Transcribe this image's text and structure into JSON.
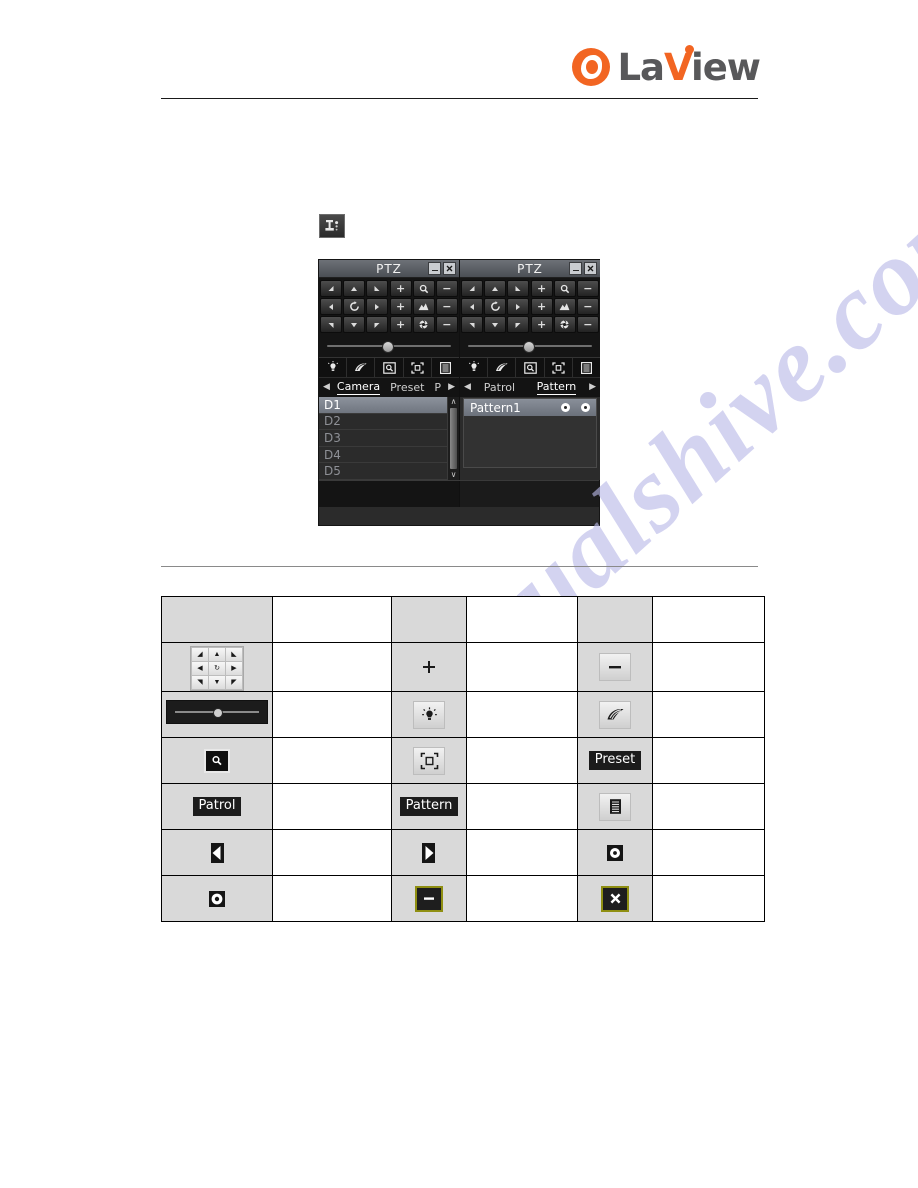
{
  "header": {
    "logo_la": "La",
    "logo_v": "V",
    "logo_iew": "iew",
    "logo_name": "LaView"
  },
  "watermark": {
    "text": "manualshive.com"
  },
  "ptz_tool_icon": {
    "name": "ptz-control-icon"
  },
  "ptz_panels": [
    {
      "title": "PTZ",
      "minimize_label": "_",
      "close_label": "×",
      "dpad": [
        "arrow-up-left",
        "arrow-up",
        "arrow-up-right",
        "arrow-left",
        "auto-scan",
        "arrow-right",
        "arrow-down-left",
        "arrow-down",
        "arrow-down-right"
      ],
      "zoom_controls": [
        {
          "plus": "+",
          "icon": "zoom-icon",
          "minus": "−"
        },
        {
          "plus": "+",
          "icon": "focus-icon",
          "minus": "−"
        },
        {
          "plus": "+",
          "icon": "iris-icon",
          "minus": "−"
        }
      ],
      "speed_slider_value": 44,
      "tools": [
        "light-icon",
        "wiper-icon",
        "zoom-in-icon",
        "center-icon",
        "menu-icon"
      ],
      "tabs": {
        "prev_arrow": "◀",
        "next_arrow": "▶",
        "items": [
          {
            "label": "Camera",
            "active": true
          },
          {
            "label": "Preset",
            "active": false
          },
          {
            "label": "P",
            "active": false
          }
        ]
      },
      "list": {
        "items": [
          {
            "label": "D1",
            "selected": true
          },
          {
            "label": "D2",
            "selected": false
          },
          {
            "label": "D3",
            "selected": false
          },
          {
            "label": "D4",
            "selected": false
          },
          {
            "label": "D5",
            "selected": false
          }
        ],
        "scroll_up": "∧",
        "scroll_down": "∨"
      }
    },
    {
      "title": "PTZ",
      "minimize_label": "_",
      "close_label": "×",
      "dpad": [
        "arrow-up-left",
        "arrow-up",
        "arrow-up-right",
        "arrow-left",
        "auto-scan",
        "arrow-right",
        "arrow-down-left",
        "arrow-down",
        "arrow-down-right"
      ],
      "zoom_controls": [
        {
          "plus": "+",
          "icon": "zoom-icon",
          "minus": "−"
        },
        {
          "plus": "+",
          "icon": "focus-icon",
          "minus": "−"
        },
        {
          "plus": "+",
          "icon": "iris-icon",
          "minus": "−"
        }
      ],
      "speed_slider_value": 48,
      "tools": [
        "light-icon",
        "wiper-icon",
        "zoom-in-icon",
        "center-icon",
        "menu-icon"
      ],
      "tabs": {
        "prev_arrow": "◀",
        "next_arrow": "▶",
        "items": [
          {
            "label": "Patrol",
            "active": false
          },
          {
            "label": "Pattern",
            "active": true
          }
        ]
      },
      "pattern": {
        "name": "Pattern1",
        "record_button": "record-icon",
        "play_button": "play-icon"
      }
    }
  ],
  "icon_table": {
    "rows": [
      {
        "cells": [
          {
            "type": "empty",
            "shade": true
          },
          {
            "type": "empty",
            "shade": false
          },
          {
            "type": "empty",
            "shade": true
          },
          {
            "type": "empty",
            "shade": false
          },
          {
            "type": "empty",
            "shade": true
          },
          {
            "type": "empty",
            "shade": false
          }
        ]
      },
      {
        "cells": [
          {
            "type": "dpad",
            "name": "direction-pad-icon",
            "shade": true
          },
          {
            "type": "empty",
            "shade": false
          },
          {
            "type": "glyph",
            "name": "zoom-in-plus-icon",
            "glyph": "+",
            "shade": true
          },
          {
            "type": "empty",
            "shade": false
          },
          {
            "type": "glyph",
            "name": "zoom-out-minus-icon",
            "glyph": "−",
            "shade": true
          },
          {
            "type": "empty",
            "shade": false
          }
        ]
      },
      {
        "cells": [
          {
            "type": "slider",
            "name": "speed-slider-icon",
            "shade": true
          },
          {
            "type": "empty",
            "shade": false
          },
          {
            "type": "svg",
            "name": "light-icon",
            "shade": true
          },
          {
            "type": "empty",
            "shade": false
          },
          {
            "type": "svg",
            "name": "wiper-icon",
            "shade": true
          },
          {
            "type": "empty",
            "shade": false
          }
        ]
      },
      {
        "cells": [
          {
            "type": "svg",
            "name": "zoom-in-box-icon",
            "shade": true
          },
          {
            "type": "empty",
            "shade": false
          },
          {
            "type": "svg",
            "name": "center-icon",
            "shade": true
          },
          {
            "type": "empty",
            "shade": false
          },
          {
            "type": "text",
            "name": "preset-button",
            "label": "Preset",
            "shade": true
          },
          {
            "type": "empty",
            "shade": false
          }
        ]
      },
      {
        "cells": [
          {
            "type": "text",
            "name": "patrol-button",
            "label": "Patrol",
            "shade": true
          },
          {
            "type": "empty",
            "shade": false
          },
          {
            "type": "text",
            "name": "pattern-button",
            "label": "Pattern",
            "shade": true
          },
          {
            "type": "empty",
            "shade": false
          },
          {
            "type": "svg",
            "name": "menu-icon",
            "shade": true
          },
          {
            "type": "empty",
            "shade": false
          }
        ]
      },
      {
        "cells": [
          {
            "type": "svg",
            "name": "previous-arrow-icon",
            "shade": true
          },
          {
            "type": "empty",
            "shade": false
          },
          {
            "type": "svg",
            "name": "next-arrow-icon",
            "shade": true
          },
          {
            "type": "empty",
            "shade": false
          },
          {
            "type": "svg",
            "name": "record-circle-icon",
            "shade": true
          },
          {
            "type": "empty",
            "shade": false
          }
        ]
      },
      {
        "cells": [
          {
            "type": "svg",
            "name": "stop-circle-icon",
            "shade": true
          },
          {
            "type": "empty",
            "shade": false
          },
          {
            "type": "svg",
            "name": "minimize-icon",
            "shade": true
          },
          {
            "type": "empty",
            "shade": false
          },
          {
            "type": "svg",
            "name": "close-icon",
            "shade": true
          },
          {
            "type": "empty",
            "shade": false
          }
        ]
      }
    ]
  }
}
